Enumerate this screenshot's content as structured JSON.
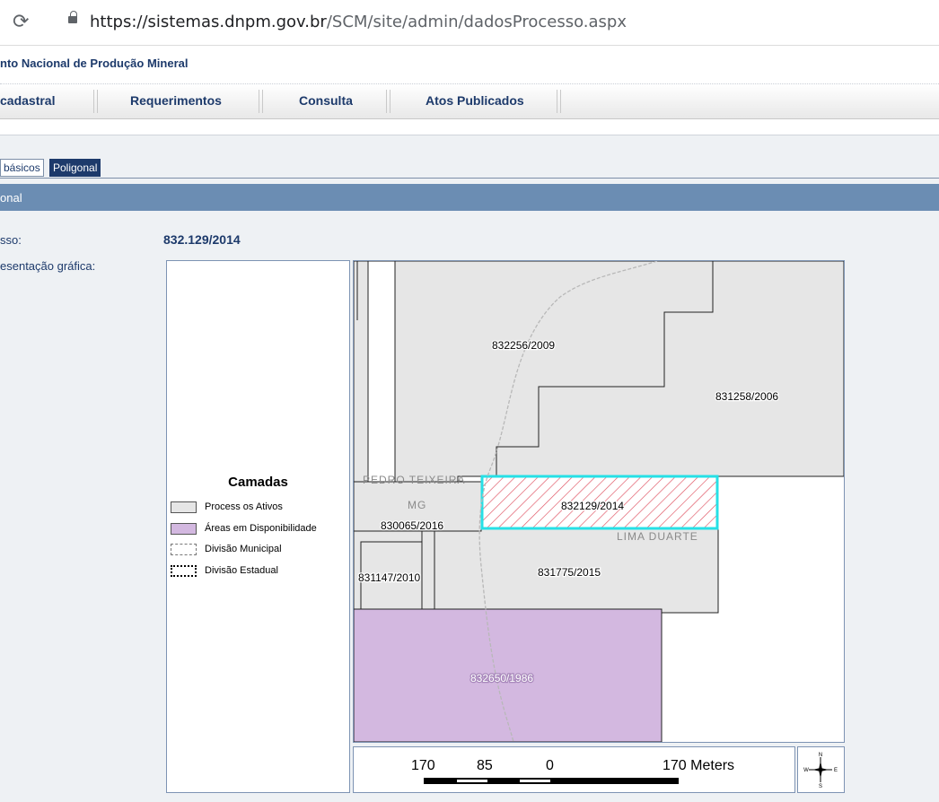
{
  "browser": {
    "url_host": "https://sistemas.dnpm.gov.br",
    "url_path": "/SCM/site/admin/dadosProcesso.aspx",
    "reload_icon": "reload-icon",
    "lock_icon": "lock-icon"
  },
  "header": {
    "title": "nto Nacional de Produção Mineral"
  },
  "menu": {
    "items": [
      "cadastral",
      "Requerimentos",
      "Consulta",
      "Atos Publicados"
    ]
  },
  "tabs": {
    "items": [
      "básicos",
      "Poligonal"
    ],
    "active": "Poligonal"
  },
  "section": {
    "title": "onal"
  },
  "fields": {
    "processo_label": "sso:",
    "processo_value": "832.129/2014",
    "representacao_label": "esentação gráfica:"
  },
  "legend": {
    "title": "Camadas",
    "items": [
      {
        "label": "Process os Ativos",
        "color": "#e6e6e6"
      },
      {
        "label": "Áreas em Disponibilidade",
        "color": "#d3b8e0"
      },
      {
        "label": "Divisão Municipal",
        "color": "#ffffff"
      },
      {
        "label": "Divisão Estadual",
        "color": "#ffffff"
      }
    ]
  },
  "map": {
    "parcel_labels": [
      "832256/2009",
      "831258/2006",
      "832129/2014",
      "830065/2016",
      "831147/2010",
      "831775/2015",
      "832650/1986"
    ],
    "place_labels": [
      "PEDRO TEIXEIRA",
      "MG",
      "LIMA DUARTE"
    ],
    "colors": {
      "active_fill": "#e6e6e6",
      "available_fill": "#d3b8e0",
      "highlight_border": "#26e0e6",
      "hatch": "#e05060"
    }
  },
  "scale": {
    "labels": [
      "170",
      "85",
      "0",
      "170 Meters"
    ]
  },
  "compass": {
    "icon": "compass-icon",
    "letters": [
      "N",
      "W",
      "E",
      "S"
    ]
  }
}
